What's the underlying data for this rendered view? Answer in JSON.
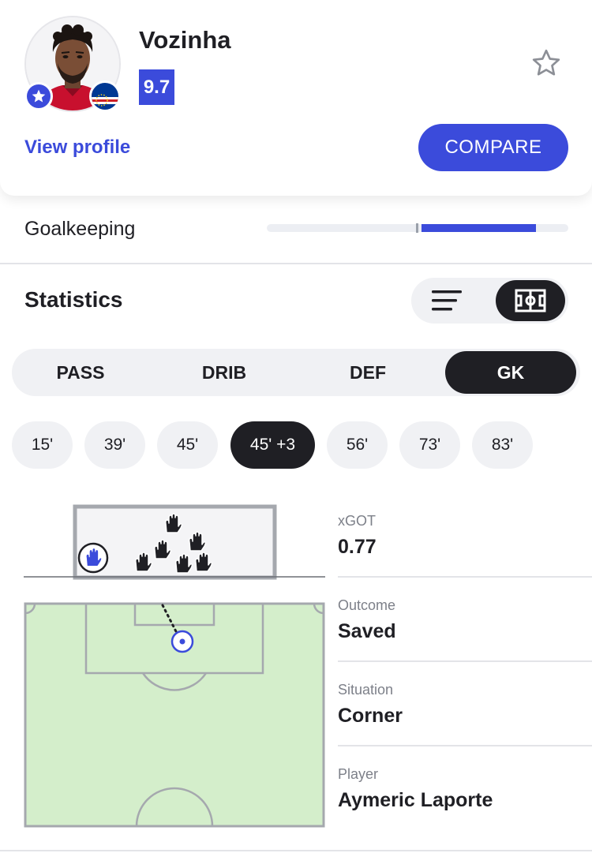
{
  "player": {
    "name": "Vozinha",
    "rating": "9.7",
    "view_profile_label": "View profile",
    "compare_label": "COMPARE",
    "accent_color": "#3b4bdb"
  },
  "goalkeeping": {
    "label": "Goalkeeping",
    "bar_fill_fraction": 0.38
  },
  "statistics": {
    "title": "Statistics",
    "view_modes": [
      "list-icon",
      "pitch-icon"
    ],
    "active_view": "pitch-icon"
  },
  "categories": {
    "items": [
      "PASS",
      "DRIB",
      "DEF",
      "GK"
    ],
    "active": "GK"
  },
  "minutes": {
    "items": [
      "15'",
      "39'",
      "45'",
      "45' +3",
      "56'",
      "73'",
      "83'"
    ],
    "active": "45' +3"
  },
  "shot": {
    "xgot_label": "xGOT",
    "xgot_value": "0.77",
    "outcome_label": "Outcome",
    "outcome_value": "Saved",
    "situation_label": "Situation",
    "situation_value": "Corner",
    "player_label": "Player",
    "player_value": "Aymeric Laporte"
  },
  "pitch": {
    "pitch_color": "#d4eecb",
    "line_color": "#a5a8ae"
  }
}
